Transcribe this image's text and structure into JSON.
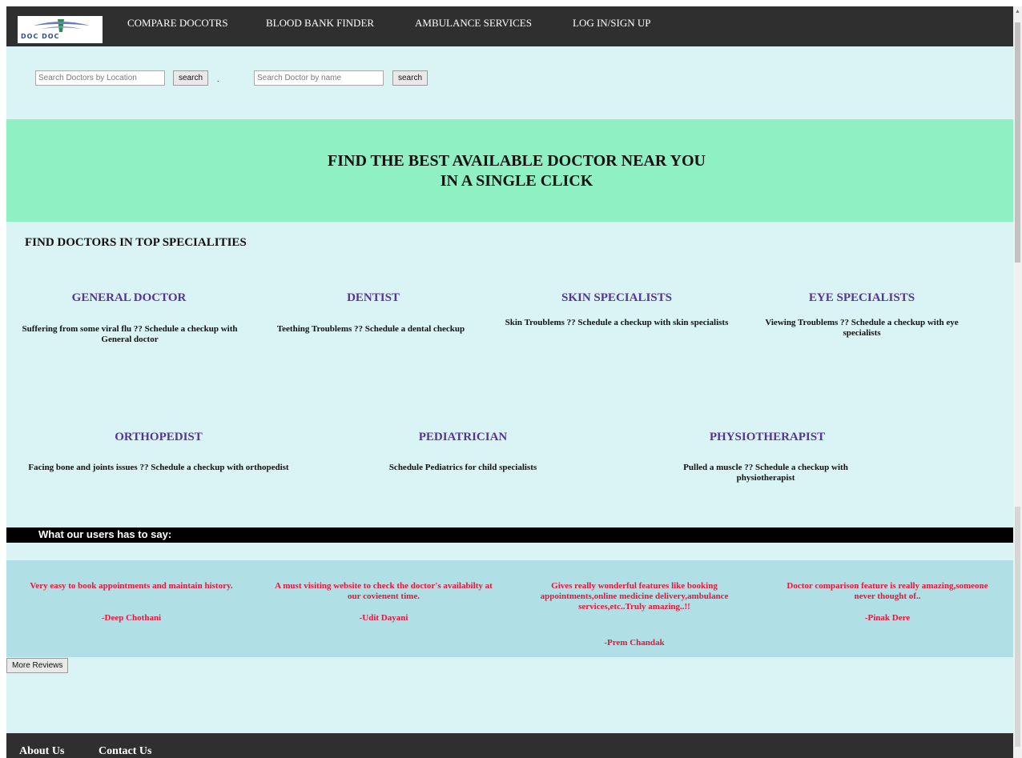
{
  "nav": {
    "logo_text": "DOC DOC",
    "links": [
      "COMPARE DOCOTRS",
      "BLOOD BANK FINDER",
      "AMBULANCE SERVICES",
      "LOG IN/SIGN UP"
    ]
  },
  "search": {
    "location_placeholder": "Search Doctors by Location",
    "name_placeholder": "Search Doctor by name",
    "button_label": "search"
  },
  "hero": {
    "line1": "FIND THE BEST AVAILABLE DOCTOR NEAR YOU",
    "line2": "IN A SINGLE CLICK"
  },
  "specialities": {
    "heading": "FIND DOCTORS IN TOP SPECIALITIES",
    "items": [
      {
        "title": "GENERAL DOCTOR",
        "desc": "Suffering from some viral flu ?? Schedule a checkup with General doctor"
      },
      {
        "title": "DENTIST",
        "desc": "Teething Troublems ?? Schedule a dental checkup"
      },
      {
        "title": "SKIN SPECIALISTS",
        "desc": "Skin Troublems ?? Schedule a checkup with skin specialists"
      },
      {
        "title": "EYE SPECIALISTS",
        "desc": "Viewing Troublems ?? Schedule a checkup with eye specialists"
      },
      {
        "title": "ORTHOPEDIST",
        "desc": "Facing bone and joints issues ?? Schedule a checkup with orthopedist"
      },
      {
        "title": "PEDIATRICIAN",
        "desc": "Schedule Pediatrics for child specialists"
      },
      {
        "title": "PHYSIOTHERAPIST",
        "desc": "Pulled a muscle ?? Schedule a checkup with physiotherapist"
      }
    ]
  },
  "reviews": {
    "heading": "What our users has to say:",
    "items": [
      {
        "text": "Very easy to book appointments and maintain history.",
        "author": "-Deep Chothani"
      },
      {
        "text": "A must visiting website to check the doctor's availabilty at our covienent time.",
        "author": "-Udit Dayani"
      },
      {
        "text": "Gives really wonderful features like booking appointments,online medicine delivery,ambulance services,etc..Truly amazing..!!",
        "author": "-Prem Chandak"
      },
      {
        "text": "Doctor comparison feature is really amazing,someone never thought of..",
        "author": "-Pinak Dere"
      }
    ],
    "more_label": "More Reviews"
  },
  "footer": {
    "links": [
      "About Us",
      "Contact Us"
    ]
  },
  "colors": {
    "nav_bg": "#2f2f2f",
    "page_bg": "#daf4f6",
    "hero_bg": "#8ff0c4",
    "title_purple": "#553399",
    "review_red": "#e8163a",
    "review_band": "#b0dfe5"
  }
}
